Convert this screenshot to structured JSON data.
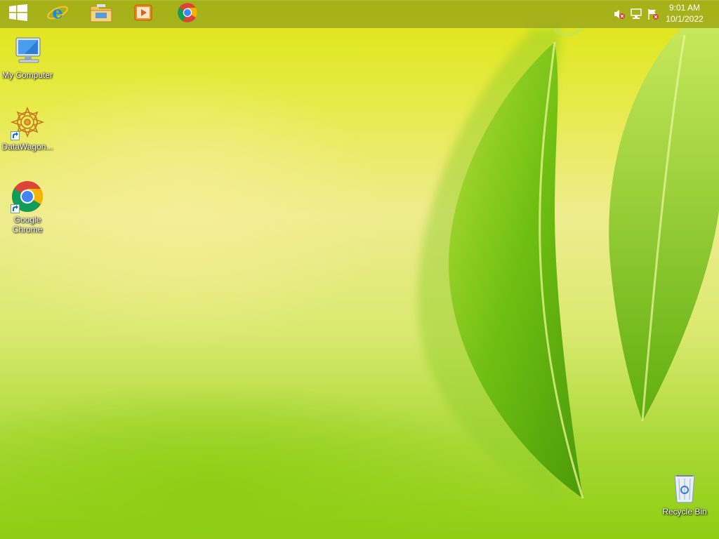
{
  "taskbar": {
    "start_icon": "windows-logo-icon",
    "pinned": [
      {
        "name": "internet-explorer",
        "icon": "internet-explorer-icon"
      },
      {
        "name": "file-explorer",
        "icon": "folder-icon"
      },
      {
        "name": "media-player",
        "icon": "media-player-icon"
      },
      {
        "name": "google-chrome",
        "icon": "chrome-icon"
      }
    ],
    "tray": {
      "icons": [
        "volume-muted-icon",
        "network-icon",
        "action-center-flag-icon"
      ],
      "time": "9:01 AM",
      "date": "10/1/2022"
    }
  },
  "desktop": {
    "icons": [
      {
        "label": "My Computer",
        "icon": "computer-icon"
      },
      {
        "label": "DataWagon...",
        "icon": "datawagon-icon"
      },
      {
        "label": "Google Chrome",
        "icon": "chrome-icon"
      },
      {
        "label": "Recycle Bin",
        "icon": "recycle-bin-icon"
      }
    ]
  },
  "colors": {
    "chrome_red": "#db4437",
    "chrome_green": "#0f9d58",
    "chrome_yellow": "#f4b400",
    "chrome_blue": "#4285f4",
    "leaf_green": "#7cc21a"
  }
}
